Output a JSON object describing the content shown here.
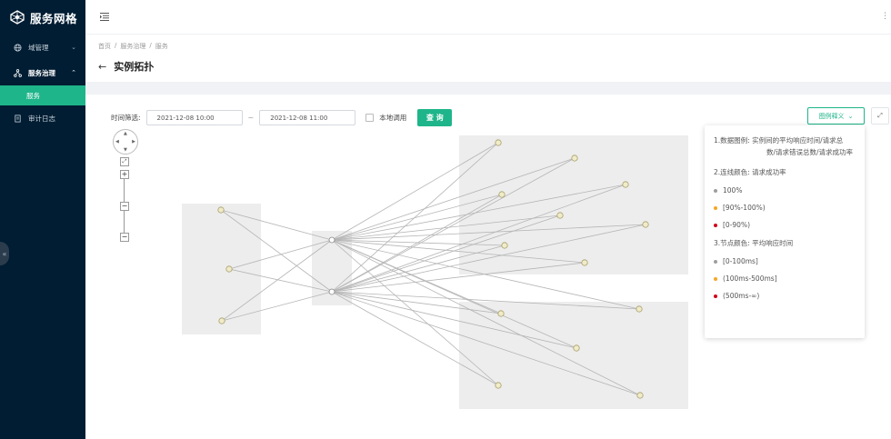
{
  "sidebar": {
    "brand": "服务网格",
    "items": [
      {
        "label": "域管理"
      },
      {
        "label": "服务治理"
      },
      {
        "label": "服务"
      },
      {
        "label": "审计日志"
      }
    ]
  },
  "breadcrumb": [
    "首页",
    "服务治理",
    "服务"
  ],
  "page_title": "实例拓扑",
  "filter": {
    "time_label": "时间筛选:",
    "start": "2021-12-08 10:00",
    "tilde": "~",
    "end": "2021-12-08 11:00",
    "local_call_label": "本地调用",
    "query_label": "查 询"
  },
  "legend_button": "图例释义",
  "legend": {
    "data_title": "1.数据图例:",
    "data_desc_1": "实例间的平均响应时间/请求总",
    "data_desc_2": "数/请求错误总数/请求成功率",
    "line_title": "2.连线颜色:",
    "line_desc": "请求成功率",
    "line_items": [
      {
        "label": "100%",
        "color": "#9e9e9e"
      },
      {
        "label": "[90%-100%)",
        "color": "#f5a623"
      },
      {
        "label": "[0-90%)",
        "color": "#d0021b"
      }
    ],
    "node_title": "3.节点颜色:",
    "node_desc": "平均响应时间",
    "node_items": [
      {
        "label": "[0-100ms]",
        "color": "#9e9e9e"
      },
      {
        "label": "(100ms-500ms]",
        "color": "#f5a623"
      },
      {
        "label": "(500ms-∞)",
        "color": "#d0021b"
      }
    ]
  },
  "colors": {
    "sidebar_bg": "#001d33",
    "accent": "#1fb58a",
    "group_bg": "#ededed"
  }
}
